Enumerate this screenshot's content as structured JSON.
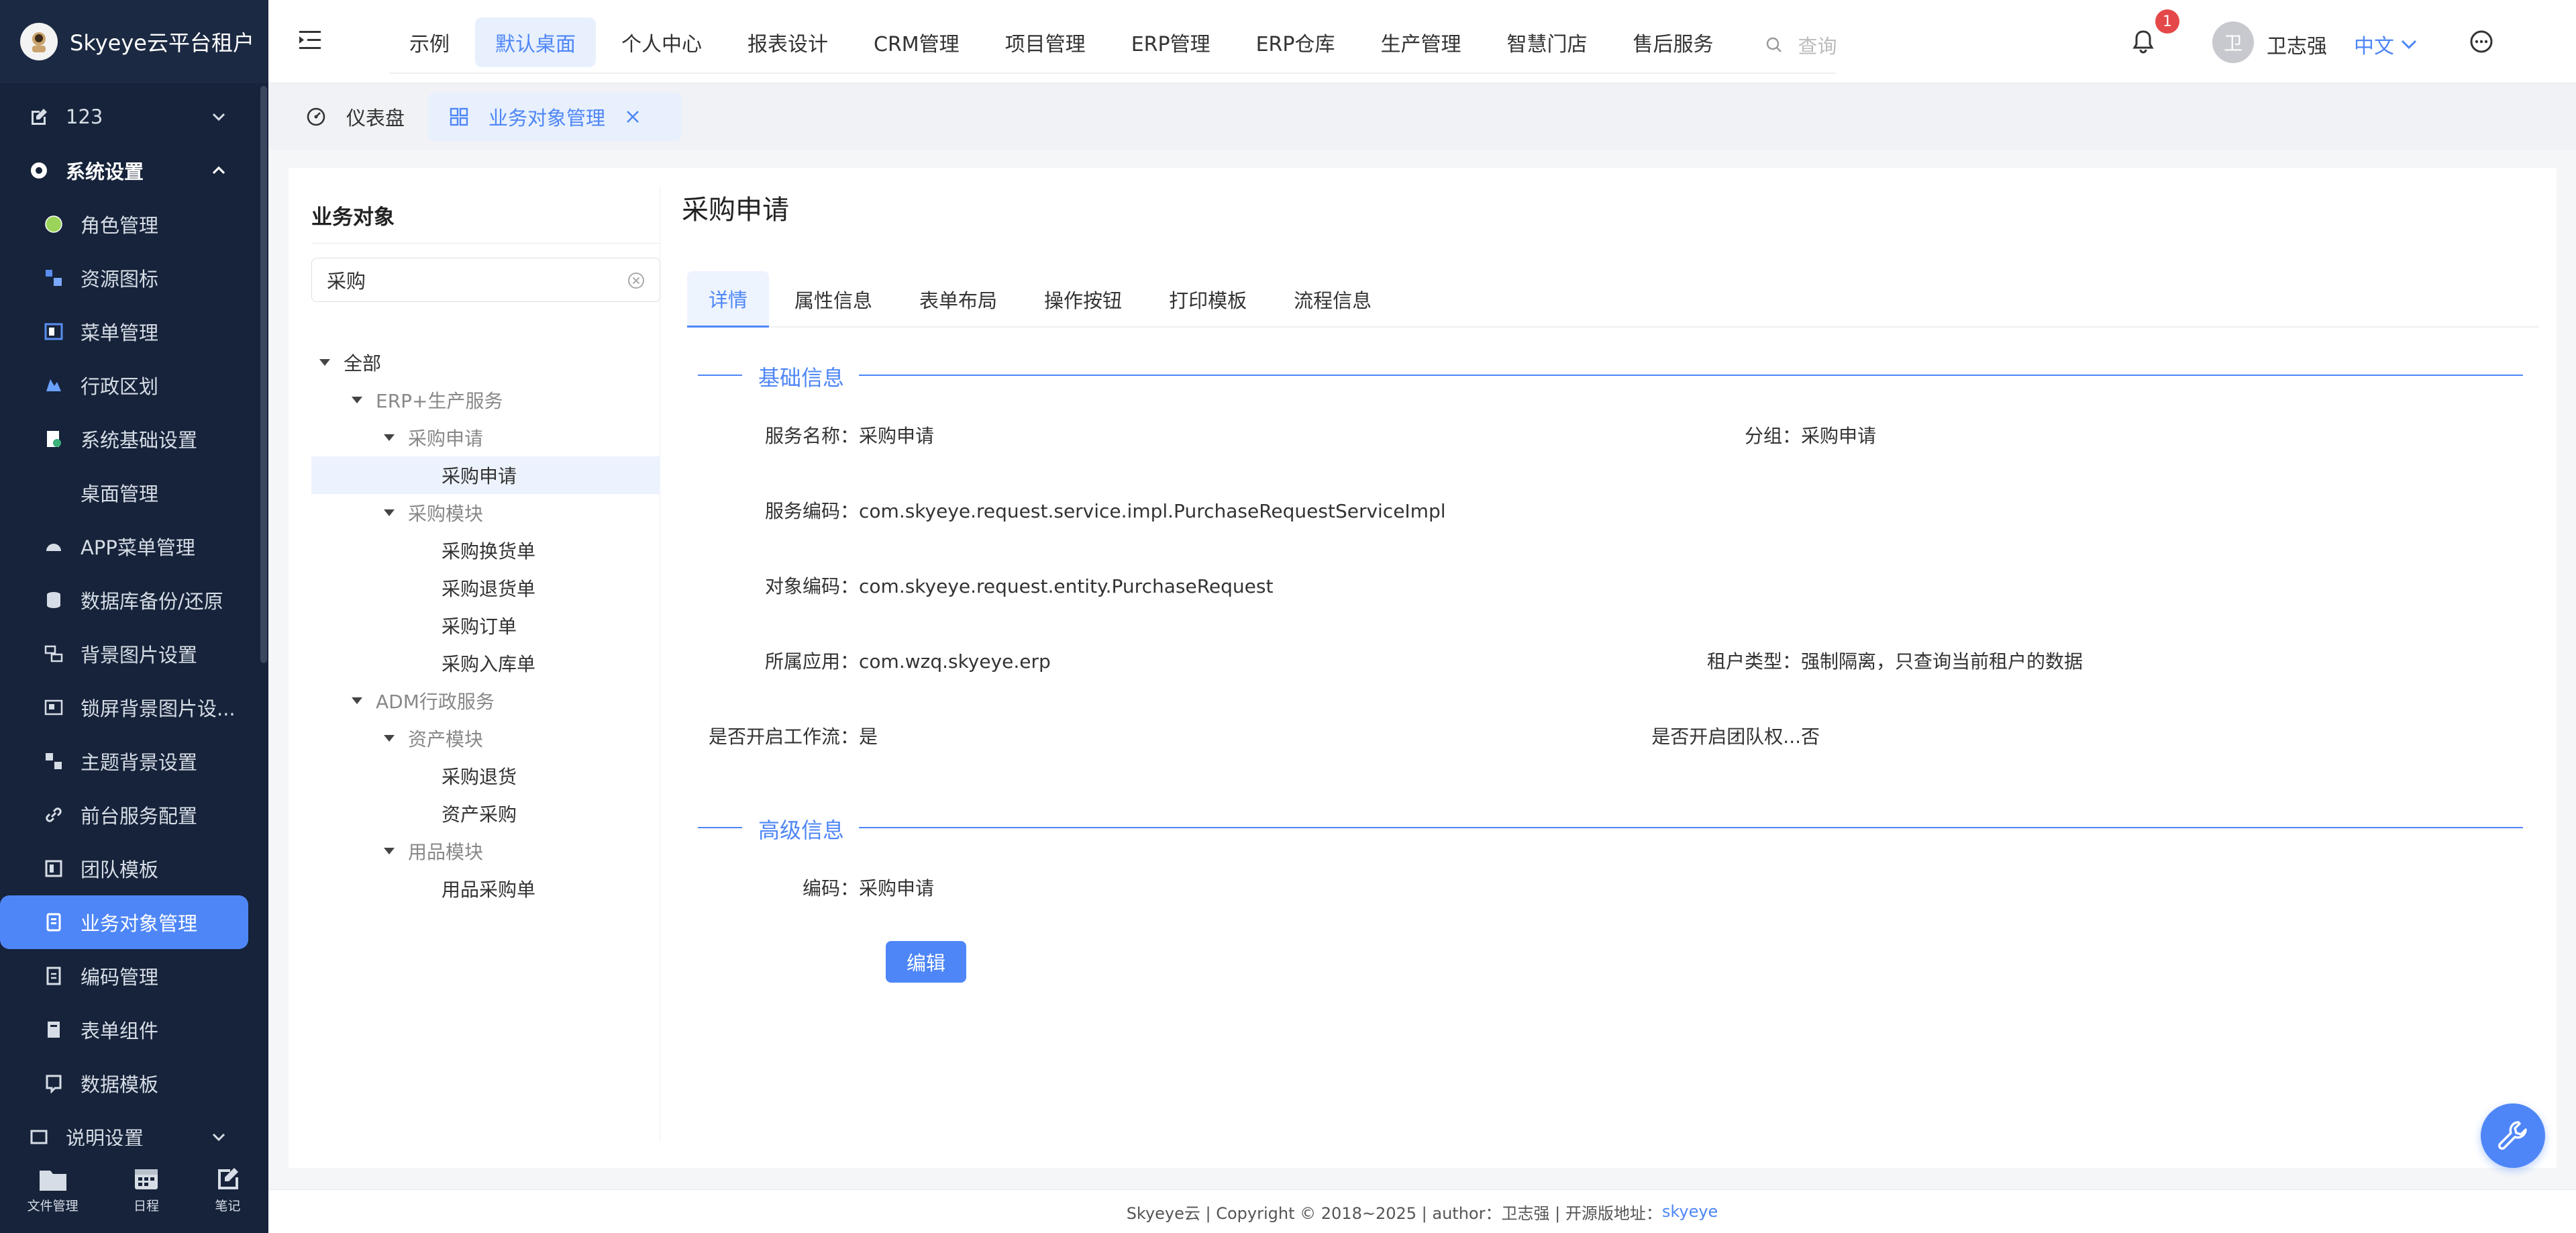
{
  "app": {
    "title": "Skyeye云平台租户"
  },
  "sidebar": {
    "items": [
      {
        "label": "123",
        "icon": "edit-icon",
        "level": "top"
      },
      {
        "label": "系统设置",
        "icon": "gear-icon",
        "level": "top"
      },
      {
        "label": "角色管理",
        "icon": "circle-icon",
        "level": "sub"
      },
      {
        "label": "资源图标",
        "icon": "resource-icon",
        "level": "sub"
      },
      {
        "label": "菜单管理",
        "icon": "menu-icon",
        "level": "sub"
      },
      {
        "label": "行政区划",
        "icon": "region-icon",
        "level": "sub"
      },
      {
        "label": "系统基础设置",
        "icon": "settings-doc-icon",
        "level": "sub"
      },
      {
        "label": "桌面管理",
        "icon": "",
        "level": "sub"
      },
      {
        "label": "APP菜单管理",
        "icon": "android-icon",
        "level": "sub"
      },
      {
        "label": "数据库备份/还原",
        "icon": "database-icon",
        "level": "sub"
      },
      {
        "label": "背景图片设置",
        "icon": "background-icon",
        "level": "sub"
      },
      {
        "label": "锁屏背景图片设...",
        "icon": "lockscreen-icon",
        "level": "sub"
      },
      {
        "label": "主题背景设置",
        "icon": "theme-icon",
        "level": "sub"
      },
      {
        "label": "前台服务配置",
        "icon": "link-icon",
        "level": "sub"
      },
      {
        "label": "团队模板",
        "icon": "team-icon",
        "level": "sub"
      },
      {
        "label": "业务对象管理",
        "icon": "object-icon",
        "level": "sub"
      },
      {
        "label": "编码管理",
        "icon": "code-icon",
        "level": "sub"
      },
      {
        "label": "表单组件",
        "icon": "form-icon",
        "level": "sub"
      },
      {
        "label": "数据模板",
        "icon": "template-icon",
        "level": "sub"
      },
      {
        "label": "说明设置",
        "icon": "note-icon",
        "level": "top"
      }
    ],
    "footer": [
      {
        "label": "文件管理",
        "icon": "folder-icon"
      },
      {
        "label": "日程",
        "icon": "calendar-icon"
      },
      {
        "label": "笔记",
        "icon": "note-edit-icon"
      }
    ]
  },
  "header": {
    "nav": [
      "示例",
      "默认桌面",
      "个人中心",
      "报表设计",
      "CRM管理",
      "项目管理",
      "ERP管理",
      "ERP仓库",
      "生产管理",
      "智慧门店",
      "售后服务"
    ],
    "active_nav": "默认桌面",
    "search_placeholder": "查询",
    "notification_count": "1",
    "avatar_initial": "卫",
    "user_name": "卫志强",
    "language": "中文"
  },
  "page_tabs": {
    "home": "仪表盘",
    "current": "业务对象管理"
  },
  "left_panel": {
    "title": "业务对象",
    "search_value": "采购",
    "tree": [
      {
        "label": "全部",
        "depth": 0,
        "expanded": true,
        "gray": false
      },
      {
        "label": "ERP+生产服务",
        "depth": 1,
        "expanded": true,
        "gray": true
      },
      {
        "label": "采购申请",
        "depth": 2,
        "expanded": true,
        "gray": true
      },
      {
        "label": "采购申请",
        "depth": 3,
        "leaf": true,
        "selected": true
      },
      {
        "label": "采购模块",
        "depth": 2,
        "expanded": true,
        "gray": true
      },
      {
        "label": "采购换货单",
        "depth": 3,
        "leaf": true
      },
      {
        "label": "采购退货单",
        "depth": 3,
        "leaf": true
      },
      {
        "label": "采购订单",
        "depth": 3,
        "leaf": true
      },
      {
        "label": "采购入库单",
        "depth": 3,
        "leaf": true
      },
      {
        "label": "ADM行政服务",
        "depth": 1,
        "expanded": true,
        "gray": true
      },
      {
        "label": "资产模块",
        "depth": 2,
        "expanded": true,
        "gray": true
      },
      {
        "label": "采购退货",
        "depth": 3,
        "leaf": true
      },
      {
        "label": "资产采购",
        "depth": 3,
        "leaf": true
      },
      {
        "label": "用品模块",
        "depth": 2,
        "expanded": true,
        "gray": true
      },
      {
        "label": "用品采购单",
        "depth": 3,
        "leaf": true
      }
    ]
  },
  "detail": {
    "title": "采购申请",
    "tabs": [
      "详情",
      "属性信息",
      "表单布局",
      "操作按钮",
      "打印模板",
      "流程信息"
    ],
    "active_tab": "详情",
    "basic_section": "基础信息",
    "advanced_section": "高级信息",
    "fields": {
      "service_name_k": "服务名称：",
      "service_name_v": "采购申请",
      "group_k": "分组：",
      "group_v": "采购申请",
      "service_code_k": "服务编码：",
      "service_code_v": "com.skyeye.request.service.impl.PurchaseRequestServiceImpl",
      "object_code_k": "对象编码：",
      "object_code_v": "com.skyeye.request.entity.PurchaseRequest",
      "app_k": "所属应用：",
      "app_v": "com.wzq.skyeye.erp",
      "tenant_k": "租户类型：",
      "tenant_v": "强制隔离，只查询当前租户的数据",
      "workflow_k": "是否开启工作流：",
      "workflow_v": "是",
      "team_k": "是否开启团队权...",
      "team_v": "否",
      "code_k": "编码：",
      "code_v": "采购申请"
    },
    "edit_button": "编辑"
  },
  "footer": {
    "text": "Skyeye云 | Copyright © 2018~2025 | author：卫志强 | 开源版地址：",
    "link": "skyeye"
  },
  "colors": {
    "accent": "#4e86f7",
    "sidebar_bg": "#16233a",
    "badge": "#e54848"
  }
}
